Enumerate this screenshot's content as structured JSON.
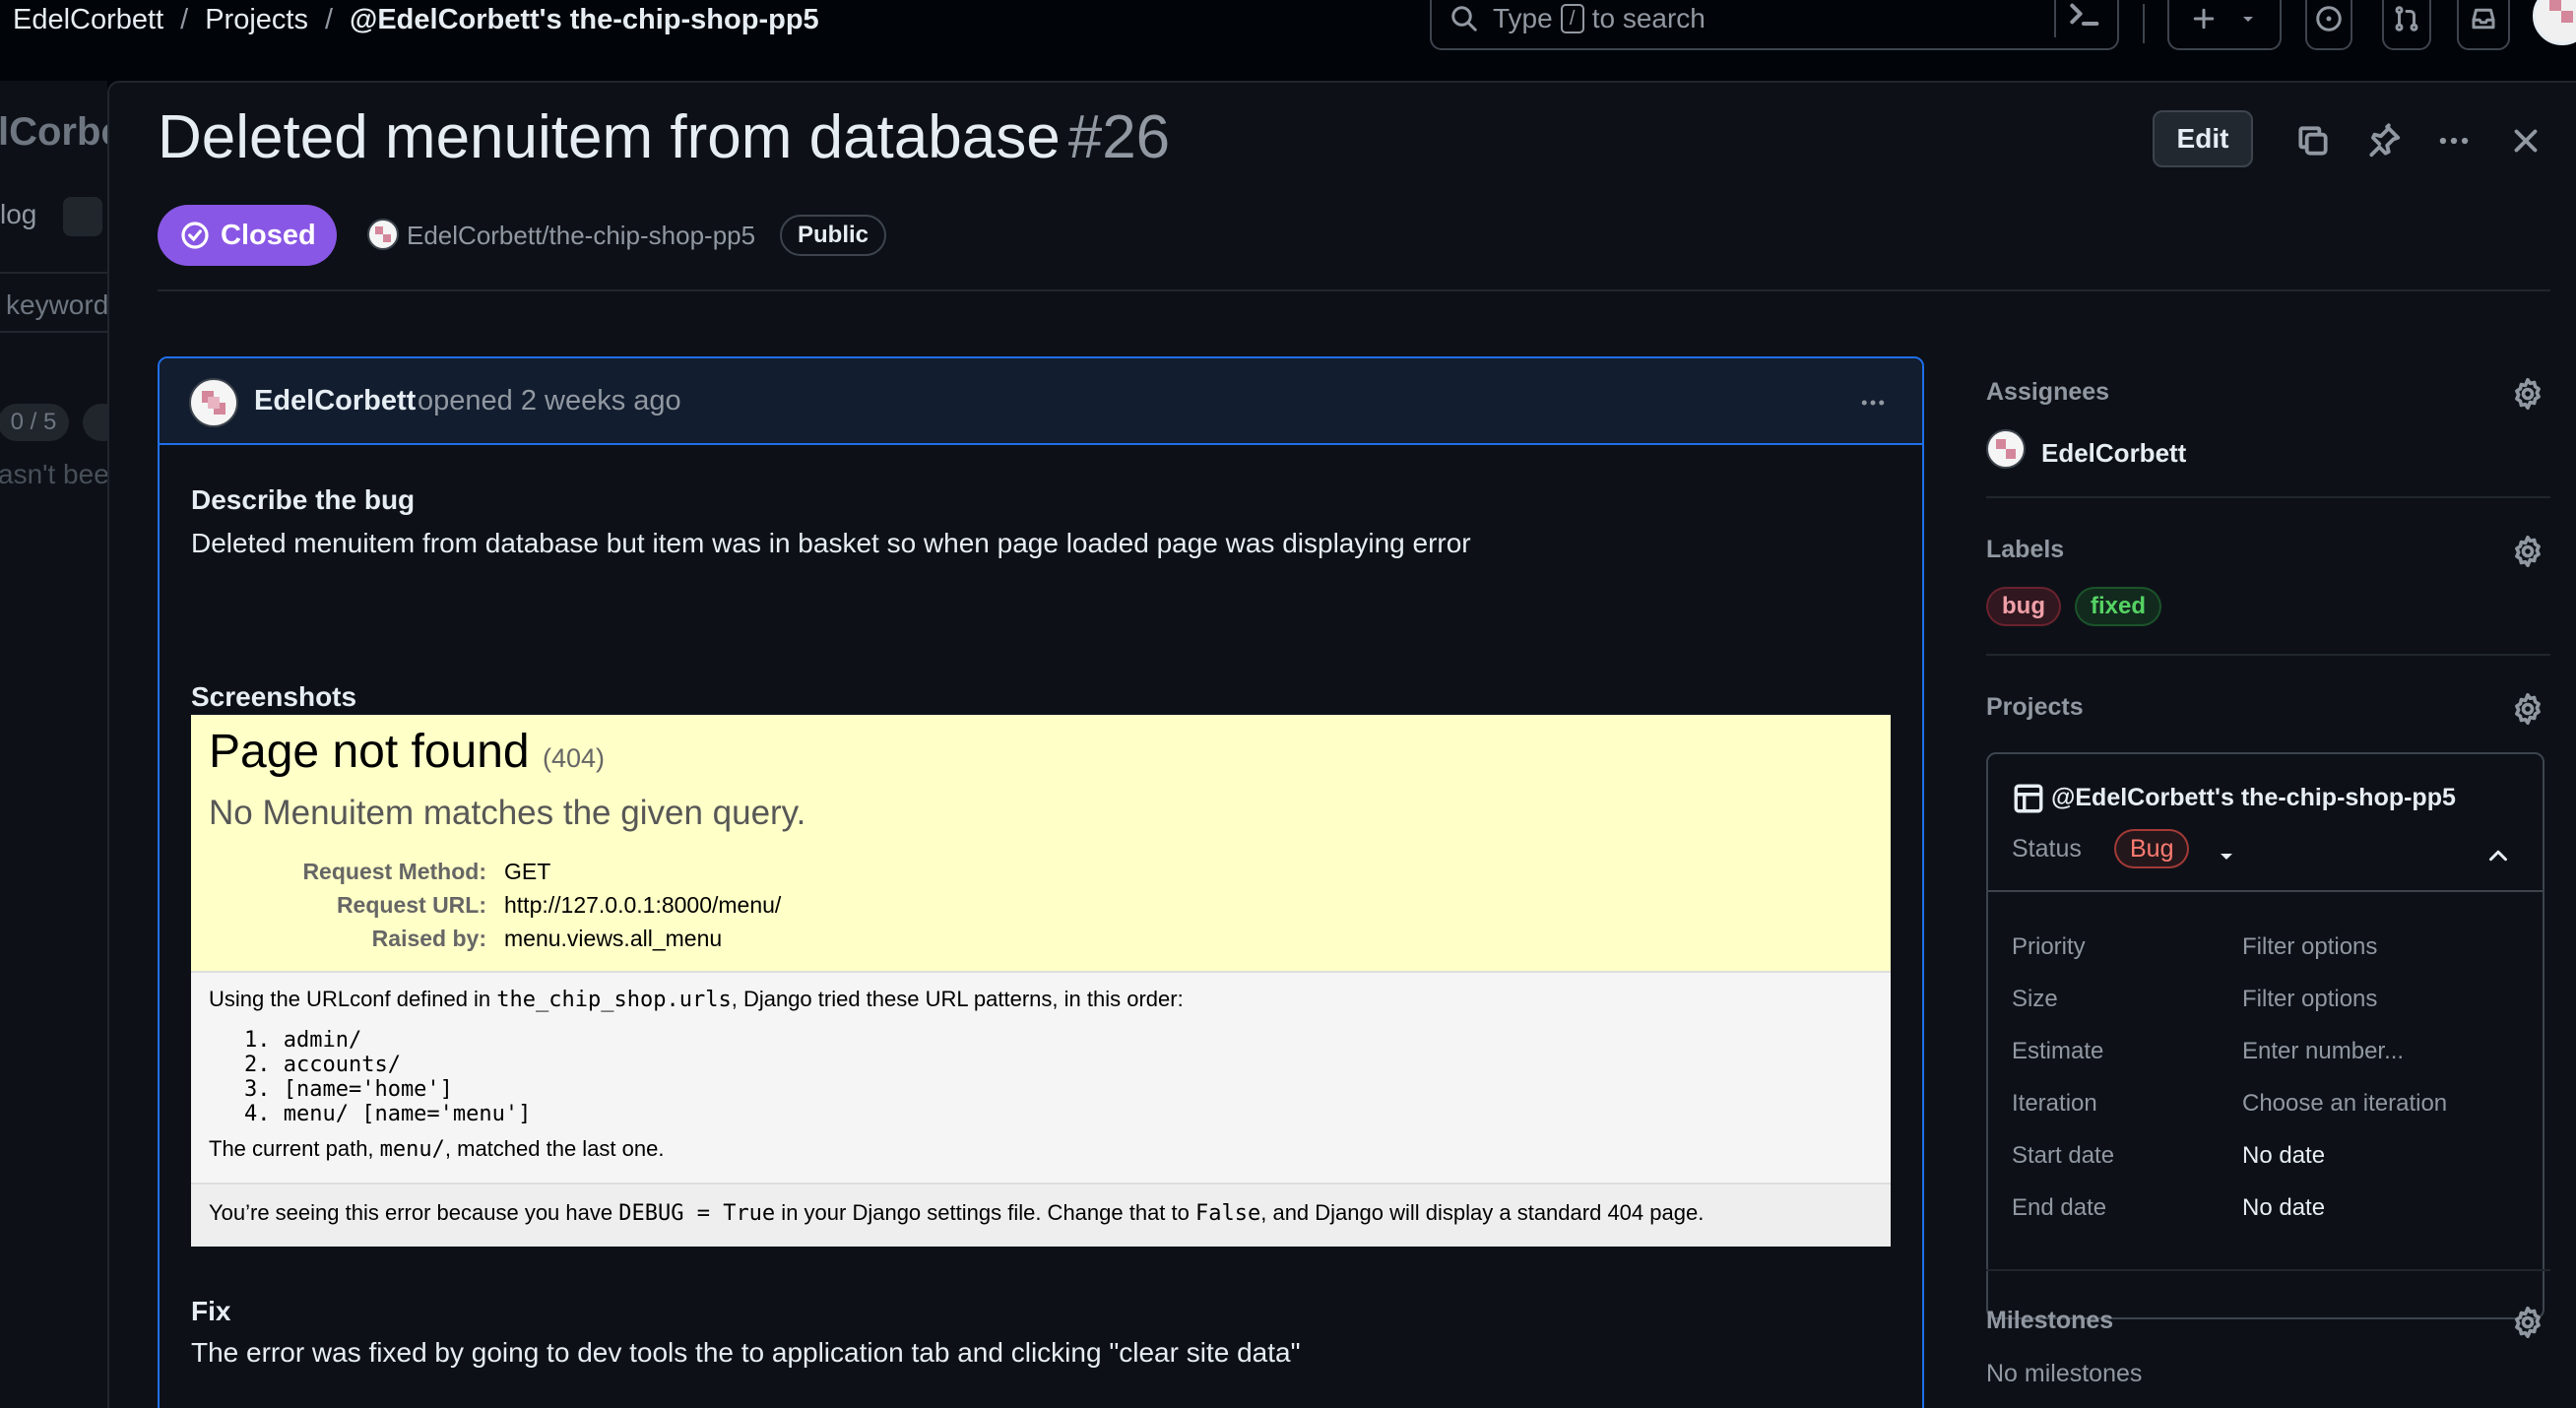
{
  "breadcrumb": {
    "owner": "EdelCorbett",
    "projects": "Projects",
    "project": "@EdelCorbett's the-chip-shop-pp5",
    "separator": "/"
  },
  "search": {
    "prefix": "Type",
    "key": "/",
    "suffix": "to search"
  },
  "left_panel": {
    "title": "lCorbe",
    "view": "log",
    "filter_placeholder": "keyword",
    "count": "0 / 5",
    "empty_text": "asn't bee"
  },
  "issue": {
    "title": "Deleted menuitem from database",
    "number": "#26",
    "state": "Closed",
    "repo": "EdelCorbett/the-chip-shop-pp5",
    "visibility": "Public",
    "edit_label": "Edit",
    "state_color": "#8957e5"
  },
  "comment": {
    "author": "EdelCorbett",
    "opened": "opened 2 weeks ago",
    "describe_heading": "Describe the bug",
    "describe_text": "Deleted menuitem from database but item was in basket so when page loaded page was displaying error",
    "screenshots_heading": "Screenshots",
    "fix_heading": "Fix",
    "fix_text": "The error was fixed by going to dev tools the to application tab and clicking \"clear site data\""
  },
  "screenshot": {
    "title": "Page not found",
    "code": "(404)",
    "subtitle": "No Menuitem matches the given query.",
    "meta_keys": [
      "Request Method:",
      "Request URL:",
      "Raised by:"
    ],
    "meta_values": [
      "GET",
      "http://127.0.0.1:8000/menu/",
      "menu.views.all_menu"
    ],
    "urlconf_pre": "Using the URLconf defined in ",
    "urlconf_code": "the_chip_shop.urls",
    "urlconf_post": ", Django tried these URL patterns, in this order:",
    "patterns": "1. admin/\n2. accounts/\n3. [name='home']\n4. menu/ [name='menu']",
    "current_pre": "The current path, ",
    "current_code": "menu/",
    "current_post": ", matched the last one.",
    "debug_pre": "You’re seeing this error because you have ",
    "debug_code": "DEBUG = True",
    "debug_mid": " in your Django settings file. Change that to ",
    "debug_code2": "False",
    "debug_post": ", and Django will display a standard 404 page."
  },
  "sidebar": {
    "assignees_heading": "Assignees",
    "assignee": "EdelCorbett",
    "labels_heading": "Labels",
    "labels": [
      "bug",
      "fixed"
    ],
    "projects_heading": "Projects",
    "project_name": "@EdelCorbett's the-chip-shop-pp5",
    "status_key": "Status",
    "status_value": "Bug",
    "fields": [
      {
        "key": "Priority",
        "value": "Filter options"
      },
      {
        "key": "Size",
        "value": "Filter options"
      },
      {
        "key": "Estimate",
        "value": "Enter number..."
      },
      {
        "key": "Iteration",
        "value": "Choose an iteration"
      },
      {
        "key": "Start date",
        "value": "No date"
      },
      {
        "key": "End date",
        "value": "No date"
      }
    ],
    "milestones_heading": "Milestones",
    "milestones_value": "No milestones"
  },
  "icons": [
    "search-icon",
    "terminal-icon",
    "plus-icon",
    "issue-icon",
    "pull-request-icon",
    "inbox-icon",
    "copy-icon",
    "pin-icon",
    "kebab-icon",
    "close-icon",
    "gear-icon",
    "table-icon",
    "chevron-up-icon",
    "smiley-icon"
  ]
}
